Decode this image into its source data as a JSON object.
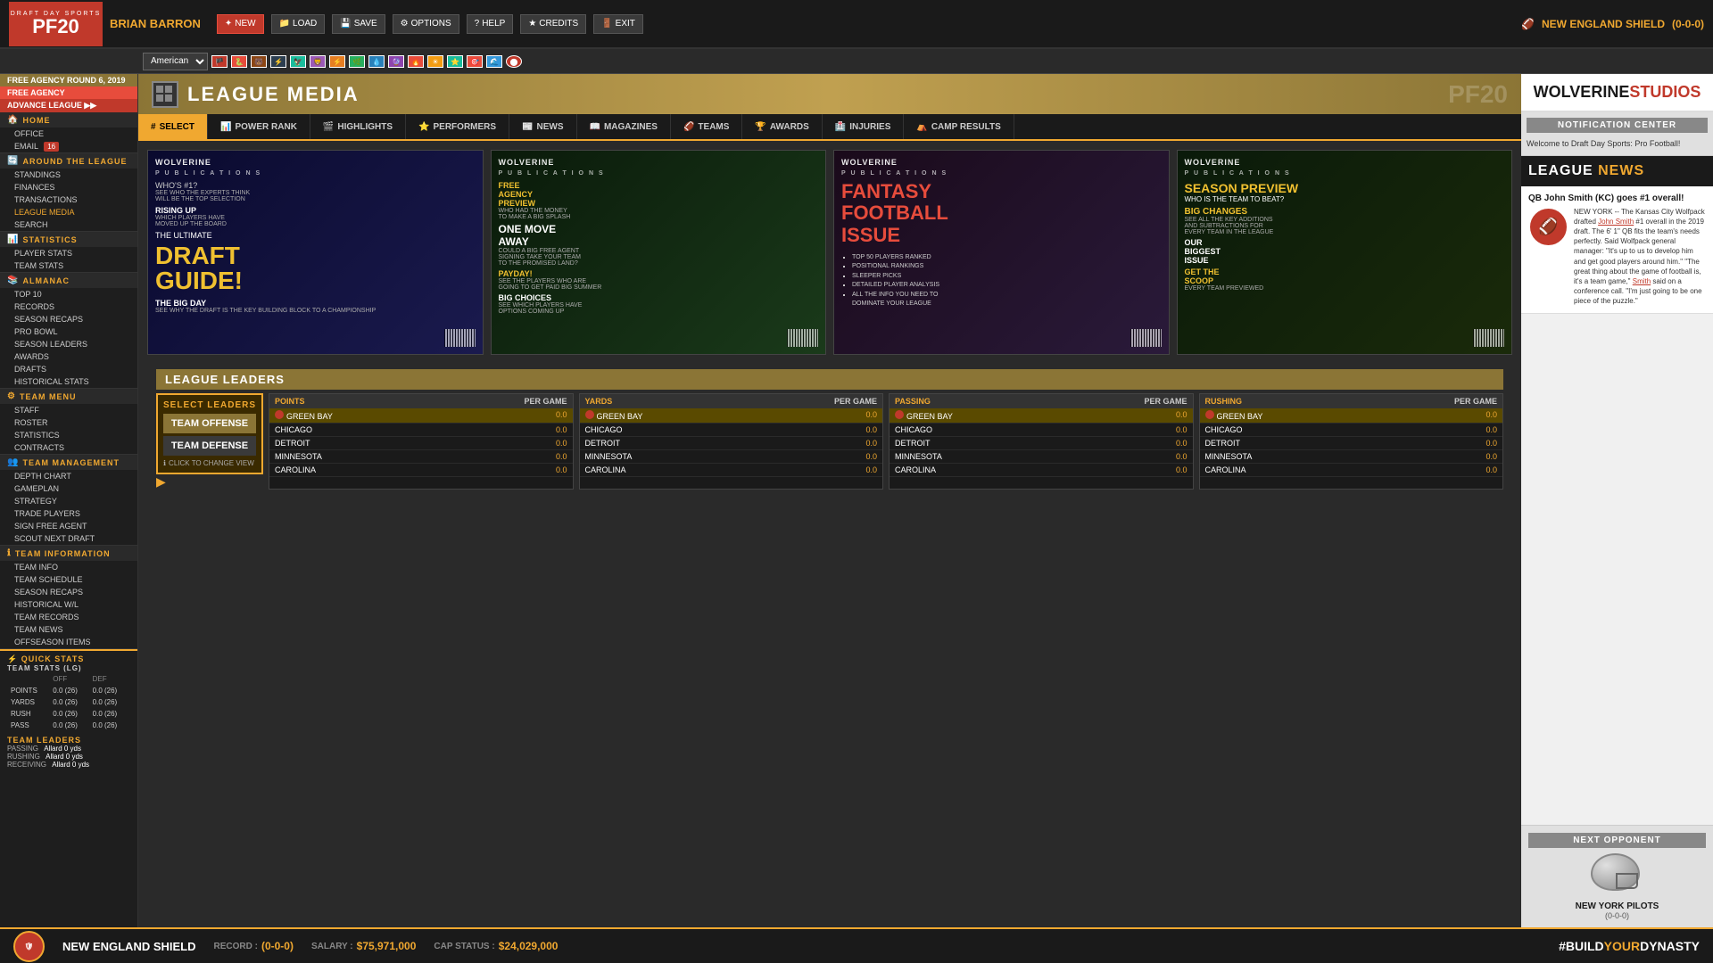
{
  "app": {
    "title": "DRAFT DAY SPORTS",
    "subtitle": "PF20",
    "free_agency": "FREE AGENCY",
    "free_agency_round": "FREE AGENCY ROUND 6, 2019",
    "advance_league": "ADVANCE LEAGUE"
  },
  "user": {
    "name": "BRIAN BARRON"
  },
  "team": {
    "name": "NEW ENGLAND SHIELD",
    "record": "(0-0-0)",
    "bottom_name": "NEW ENGLAND SHIELD",
    "record_label": "RECORD :",
    "record_value": "(0-0-0)",
    "salary_label": "SALARY :",
    "salary_value": "$75,971,000",
    "cap_label": "CAP STATUS :",
    "cap_value": "$24,029,000"
  },
  "toolbar": {
    "new": "NEW",
    "load": "LOAD",
    "save": "SAVE",
    "options": "OPTIONS",
    "help": "HELP",
    "credits": "CREDITS",
    "exit": "EXIT"
  },
  "conference": {
    "selected": "American"
  },
  "page_title": "LEAGUE MEDIA",
  "nav_tabs": [
    {
      "id": "select",
      "label": "SELECT",
      "icon": "#",
      "active": true
    },
    {
      "id": "power_rank",
      "label": "POWER RANK",
      "icon": "📊"
    },
    {
      "id": "highlights",
      "label": "HIGHLIGHTS",
      "icon": "🎬"
    },
    {
      "id": "performers",
      "label": "PERFORMERS",
      "icon": "⭐"
    },
    {
      "id": "news",
      "label": "NEWS",
      "icon": "📰"
    },
    {
      "id": "magazines",
      "label": "MAGAZINES",
      "icon": "📖"
    },
    {
      "id": "teams",
      "label": "TEAMS",
      "icon": "🏈"
    },
    {
      "id": "awards",
      "label": "AWARDS",
      "icon": "🏆"
    },
    {
      "id": "injuries",
      "label": "INJURIES",
      "icon": "🏥"
    },
    {
      "id": "camp_results",
      "label": "CAMP RESULTS",
      "icon": "⛺"
    }
  ],
  "magazines": [
    {
      "publisher": "WOLVERINE\nPUBLICATIONS",
      "title": "DRAFT\nGUIDE!",
      "heading1": "WHO'S #1?",
      "heading2": "RISING UP",
      "heading3": "THE ULTIMATE",
      "heading4": "THE BIG DAY",
      "body": "SEE WHY THE DRAFT IS THE KEY BUILDING BLOCK TO A CHAMPIONSHIP",
      "color": "yellow"
    },
    {
      "publisher": "WOLVERINE\nPUBLICATIONS",
      "title": "FREE\nAGENCY\nPREVIEW",
      "subhead": "ONE MOVE AWAY",
      "body1": "PAYDAY!",
      "body2": "BIG CHOICES",
      "desc1": "WHO HAD THE MONEY TO MAKE A BIG SPLASH",
      "desc2": "SEE THE PLAYERS WHO ARE GOING TO GET PAID BIG SUMMER",
      "desc3": "SEE WHICH PLAYERS HAVE OPTIONS COMING UP",
      "color": "yellow"
    },
    {
      "publisher": "WOLVERINE\nPUBLICATIONS",
      "title": "FANTASY\nFOOTBALL\nISSUE",
      "items": [
        "TOP 50 PLAYERS RANKED",
        "POSITIONAL RANKINGS",
        "SLEEPER PICKS",
        "DETAILED PLAYER ANALYSIS",
        "ALL THE INFO YOU NEED TO DOMINATE YOUR LEAGUE"
      ],
      "color": "orange"
    },
    {
      "publisher": "WOLVERINE\nPUBLICATIONS",
      "title": "SEASON PREVIEW",
      "subhead": "WHO IS THE TEAM TO BEAT?",
      "heading": "BIG CHANGES",
      "desc": "SEE ALL THE KEY ADDITIONS AND SUBTRACTIONS FOR EVERY TEAM IN THE LEAGUE",
      "cta": "GET THE SCOOP",
      "cta_desc": "EVERY TEAM PREVIEWED",
      "highlight": "OUR BIGGEST ISSUE",
      "color": "yellow"
    }
  ],
  "sidebar": {
    "sections": [
      {
        "id": "home",
        "label": "HOME",
        "icon": "🏠",
        "items": [
          {
            "label": "OFFICE"
          },
          {
            "label": "EMAIL",
            "badge": "16"
          }
        ]
      },
      {
        "id": "around_league",
        "label": "AROUND THE LEAGUE",
        "icon": "🔄",
        "items": [
          {
            "label": "STANDINGS"
          },
          {
            "label": "FINANCES"
          },
          {
            "label": "TRANSACTIONS"
          },
          {
            "label": "LEAGUE MEDIA",
            "active": true
          },
          {
            "label": "SEARCH"
          }
        ]
      },
      {
        "id": "statistics",
        "label": "STATISTICS",
        "icon": "📊",
        "items": [
          {
            "label": "PLAYER STATS"
          },
          {
            "label": "TEAM STATS"
          }
        ]
      },
      {
        "id": "almanac",
        "label": "ALMANAC",
        "icon": "📚",
        "items": [
          {
            "label": "TOP 10"
          },
          {
            "label": "RECORDS"
          },
          {
            "label": "SEASON RECAPS"
          },
          {
            "label": "PRO BOWL"
          },
          {
            "label": "SEASON LEADERS"
          },
          {
            "label": "AWARDS"
          },
          {
            "label": "DRAFTS"
          },
          {
            "label": "HISTORICAL STATS"
          }
        ]
      },
      {
        "id": "team_menu",
        "label": "TEAM MENU",
        "icon": "⚙",
        "items": [
          {
            "label": "STAFF"
          },
          {
            "label": "ROSTER"
          },
          {
            "label": "STATISTICS"
          },
          {
            "label": "CONTRACTS"
          }
        ]
      },
      {
        "id": "team_management",
        "label": "TEAM MANAGEMENT",
        "icon": "👥",
        "items": [
          {
            "label": "DEPTH CHART"
          },
          {
            "label": "GAMEPLAN"
          },
          {
            "label": "STRATEGY"
          },
          {
            "label": "TRADE PLAYERS"
          },
          {
            "label": "SIGN FREE AGENT"
          },
          {
            "label": "SCOUT NEXT DRAFT"
          }
        ]
      },
      {
        "id": "team_information",
        "label": "TEAM INFORMATION",
        "icon": "ℹ",
        "items": [
          {
            "label": "TEAM INFO"
          },
          {
            "label": "TEAM SCHEDULE"
          },
          {
            "label": "SEASON RECAPS"
          },
          {
            "label": "HISTORICAL W/L"
          },
          {
            "label": "TEAM RECORDS"
          },
          {
            "label": "TEAM NEWS"
          },
          {
            "label": "OFFSEASON ITEMS"
          }
        ]
      }
    ]
  },
  "quick_stats": {
    "label": "QUICK STATS",
    "team_stats_lg": "TEAM STATS (LG)",
    "headers": [
      "",
      "DEF",
      "DEF"
    ],
    "rows": [
      {
        "label": "POINTS",
        "off": "0.0 (26)",
        "def": "0.0 (26)"
      },
      {
        "label": "YARDS",
        "off": "0.0 (26)",
        "def": "0.0 (26)"
      },
      {
        "label": "RUSH",
        "off": "0.0 (26)",
        "def": "0.0 (26)"
      },
      {
        "label": "PASS",
        "off": "0.0 (26)",
        "def": "0.0 (26)"
      }
    ],
    "team_leaders": "TEAM LEADERS",
    "passing": "PASSING",
    "passing_value": "Allard 0 yds",
    "rushing": "RUSHING",
    "rushing_value": "Allard 0 yds",
    "receiving": "RECEIVING",
    "receiving_value": "Allard 0 yds"
  },
  "league_leaders": {
    "title": "LEAGUE LEADERS",
    "select_label": "SELECT LEADERS",
    "offense_label": "TEAM OFFENSE",
    "defense_label": "TEAM DEFENSE",
    "change_view": "CLICK TO CHANGE VIEW",
    "tables": [
      {
        "stat": "POINTS",
        "per": "PER GAME",
        "rows": [
          {
            "team": "GREEN BAY",
            "value": "0.0",
            "highlight": true
          },
          {
            "team": "CHICAGO",
            "value": "0.0"
          },
          {
            "team": "DETROIT",
            "value": "0.0"
          },
          {
            "team": "MINNESOTA",
            "value": "0.0"
          },
          {
            "team": "CAROLINA",
            "value": "0.0"
          }
        ]
      },
      {
        "stat": "YARDS",
        "per": "PER GAME",
        "rows": [
          {
            "team": "GREEN BAY",
            "value": "0.0",
            "highlight": true
          },
          {
            "team": "CHICAGO",
            "value": "0.0"
          },
          {
            "team": "DETROIT",
            "value": "0.0"
          },
          {
            "team": "MINNESOTA",
            "value": "0.0"
          },
          {
            "team": "CAROLINA",
            "value": "0.0"
          }
        ]
      },
      {
        "stat": "PASSING",
        "per": "PER GAME",
        "rows": [
          {
            "team": "GREEN BAY",
            "value": "0.0",
            "highlight": true
          },
          {
            "team": "CHICAGO",
            "value": "0.0"
          },
          {
            "team": "DETROIT",
            "value": "0.0"
          },
          {
            "team": "MINNESOTA",
            "value": "0.0"
          },
          {
            "team": "CAROLINA",
            "value": "0.0"
          }
        ]
      },
      {
        "stat": "RUSHING",
        "per": "PER GAME",
        "rows": [
          {
            "team": "GREEN BAY",
            "value": "0.0",
            "highlight": true
          },
          {
            "team": "CHICAGO",
            "value": "0.0"
          },
          {
            "team": "DETROIT",
            "value": "0.0"
          },
          {
            "team": "MINNESOTA",
            "value": "0.0"
          },
          {
            "team": "CAROLINA",
            "value": "0.0"
          }
        ]
      }
    ]
  },
  "right_panel": {
    "wolverine_studios": "WOLVERINESTUDIOS",
    "notification_center": "NOTIFICATION CENTER",
    "notification_text": "Welcome to Draft Day Sports: Pro Football!",
    "league_news": "LEAGUE NEWS",
    "news_items": [
      {
        "headline": "QB John Smith (KC) goes #1 overall!",
        "text": "NEW YORK -- The Kansas City Wolfpack drafted John Smith #1 overall in the 2019 draft. The 6' 1\" QB fits the team's needs perfectly. Said Wolfpack general manager: \"It's up to us to develop him and get good players around him.\" \"The great thing about the game of football is, it's a team game,\" Smith said on a conference call. \"I'm just going to be one piece of the puzzle.\""
      }
    ],
    "next_opponent": "NEXT OPPONENT",
    "next_opponent_team": "NEW YORK PILOTS",
    "next_opponent_record": "(0-0-0)"
  },
  "bottom": {
    "hashtag": "#BUILDYOURDYNASTY"
  }
}
